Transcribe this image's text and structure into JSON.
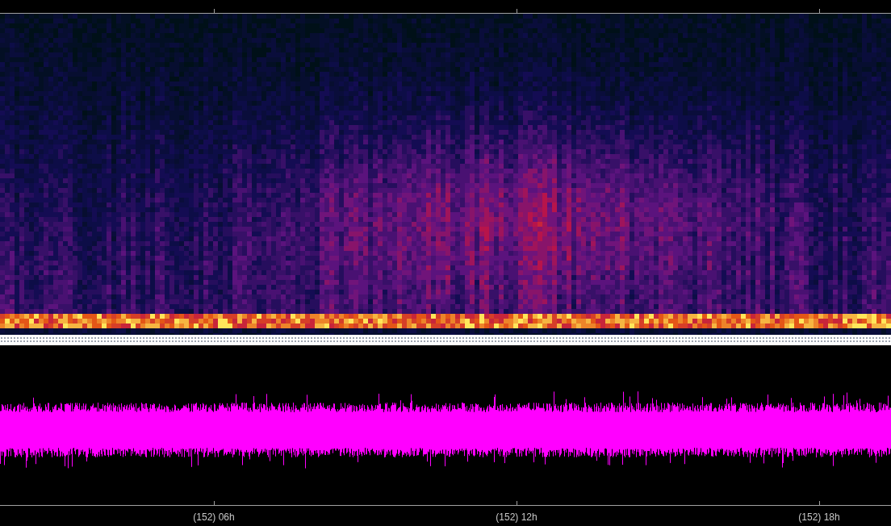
{
  "time_axis": {
    "labels": [
      "(152) 06h",
      "(152) 12h",
      "(152) 18h"
    ]
  }
}
